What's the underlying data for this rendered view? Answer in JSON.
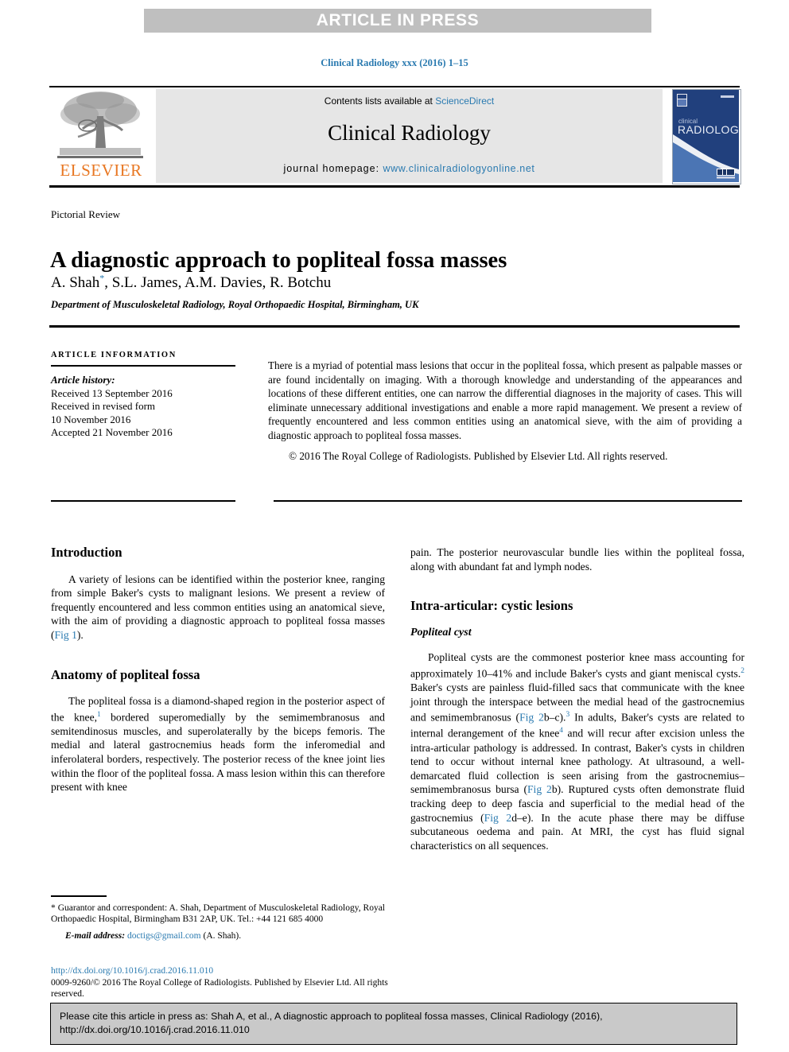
{
  "banner": {
    "label": "ARTICLE IN PRESS"
  },
  "running_head": "Clinical Radiology xxx (2016) 1–15",
  "masthead": {
    "contents_prefix": "Contents lists available at ",
    "contents_link": "ScienceDirect",
    "journal_name": "Clinical Radiology",
    "homepage_prefix": "journal homepage: ",
    "homepage_link": "www.clinicalradiologyonline.net",
    "publisher_wordmark": "ELSEVIER",
    "cover_title_top": "clinical",
    "cover_title_main": "RADIOLOGY"
  },
  "article": {
    "section_type": "Pictorial Review",
    "title": "A diagnostic approach to popliteal fossa masses",
    "authors": "A. Shah, S.L. James, A.M. Davies, R. Botchu",
    "author_marker": "*",
    "affiliation": "Department of Musculoskeletal Radiology, Royal Orthopaedic Hospital, Birmingham, UK"
  },
  "article_information": {
    "heading": "ARTICLE INFORMATION",
    "history_label": "Article history:",
    "received": "Received 13 September 2016",
    "revised_label": "Received in revised form",
    "revised_date": "10 November 2016",
    "accepted": "Accepted 21 November 2016"
  },
  "abstract": {
    "text": "There is a myriad of potential mass lesions that occur in the popliteal fossa, which present as palpable masses or are found incidentally on imaging. With a thorough knowledge and understanding of the appearances and locations of these different entities, one can narrow the differential diagnoses in the majority of cases. This will eliminate unnecessary additional investigations and enable a more rapid management. We present a review of frequently encountered and less common entities using an anatomical sieve, with the aim of providing a diagnostic approach to popliteal fossa masses.",
    "copyright": "© 2016 The Royal College of Radiologists. Published by Elsevier Ltd. All rights reserved."
  },
  "body": {
    "left": {
      "h_introduction": "Introduction",
      "p_introduction_a": "A variety of lesions can be identified within the posterior knee, ranging from simple Baker's cysts to malignant lesions. We present a review of frequently encountered and less common entities using an anatomical sieve, with the aim of providing a diagnostic approach to popliteal fossa masses (",
      "p_introduction_link": "Fig 1",
      "p_introduction_b": ").",
      "h_anatomy": "Anatomy of popliteal fossa",
      "p_anatomy_a": "The popliteal fossa is a diamond-shaped region in the posterior aspect of the knee,",
      "p_anatomy_ref1": "1",
      "p_anatomy_b": " bordered superomedially by the semimembranosus and semitendinosus muscles, and superolaterally by the biceps femoris. The medial and lateral gastrocnemius heads form the inferomedial and inferolateral borders, respectively. The posterior recess of the knee joint lies within the floor of the popliteal fossa. A mass lesion within this can therefore present with knee"
    },
    "right": {
      "p_continuation": "pain. The posterior neurovascular bundle lies within the popliteal fossa, along with abundant fat and lymph nodes.",
      "h_intraarticular": "Intra-articular: cystic lesions",
      "h_popliteal_cyst": "Popliteal cyst",
      "p_cyst_a": "Popliteal cysts are the commonest posterior knee mass accounting for approximately 10–41% and include Baker's cysts and giant meniscal cysts.",
      "p_cyst_ref2": "2",
      "p_cyst_b": " Baker's cysts are painless fluid-filled sacs that communicate with the knee joint through the interspace between the medial head of the gastrocnemius and semimembranosus (",
      "p_cyst_link1": "Fig 2",
      "p_cyst_c": "b–c).",
      "p_cyst_ref3": "3",
      "p_cyst_d": " In adults, Baker's cysts are related to internal derangement of the knee",
      "p_cyst_ref4": "4",
      "p_cyst_e": " and will recur after excision unless the intra-articular pathology is addressed. In contrast, Baker's cysts in children tend to occur without internal knee pathology. At ultrasound, a well-demarcated fluid collection is seen arising from the gastrocnemius–semimembranosus bursa (",
      "p_cyst_link2": "Fig 2",
      "p_cyst_f": "b). Ruptured cysts often demonstrate fluid tracking deep to deep fascia and superficial to the medial head of the gastrocnemius (",
      "p_cyst_link3": "Fig 2",
      "p_cyst_g": "d–e). In the acute phase there may be diffuse subcutaneous oedema and pain. At MRI, the cyst has fluid signal characteristics on all sequences."
    }
  },
  "footnote": {
    "marker": "*",
    "text": " Guarantor and correspondent: A. Shah, Department of Musculoskeletal Radiology, Royal Orthopaedic Hospital, Birmingham B31 2AP, UK. Tel.: +44 121 685 4000",
    "email_label": "E-mail address:",
    "email_address": "doctigs@gmail.com",
    "email_owner": "(A. Shah).",
    "doi_url": "http://dx.doi.org/10.1016/j.crad.2016.11.010",
    "issn_line": "0009-9260/© 2016 The Royal College of Radiologists. Published by Elsevier Ltd. All rights reserved."
  },
  "citation_box": {
    "text": "Please cite this article in press as: Shah A, et al., A diagnostic approach to popliteal fossa masses, Clinical Radiology (2016), http://dx.doi.org/10.1016/j.crad.2016.11.010"
  },
  "colors": {
    "link": "#2a7ab0",
    "banner_bg": "#bfbfbf",
    "masthead_bg": "#e6e6e6",
    "elsevier_orange": "#e87722",
    "cite_box_bg": "#c9c9c9",
    "cover_blue": "#1f3f7a"
  }
}
